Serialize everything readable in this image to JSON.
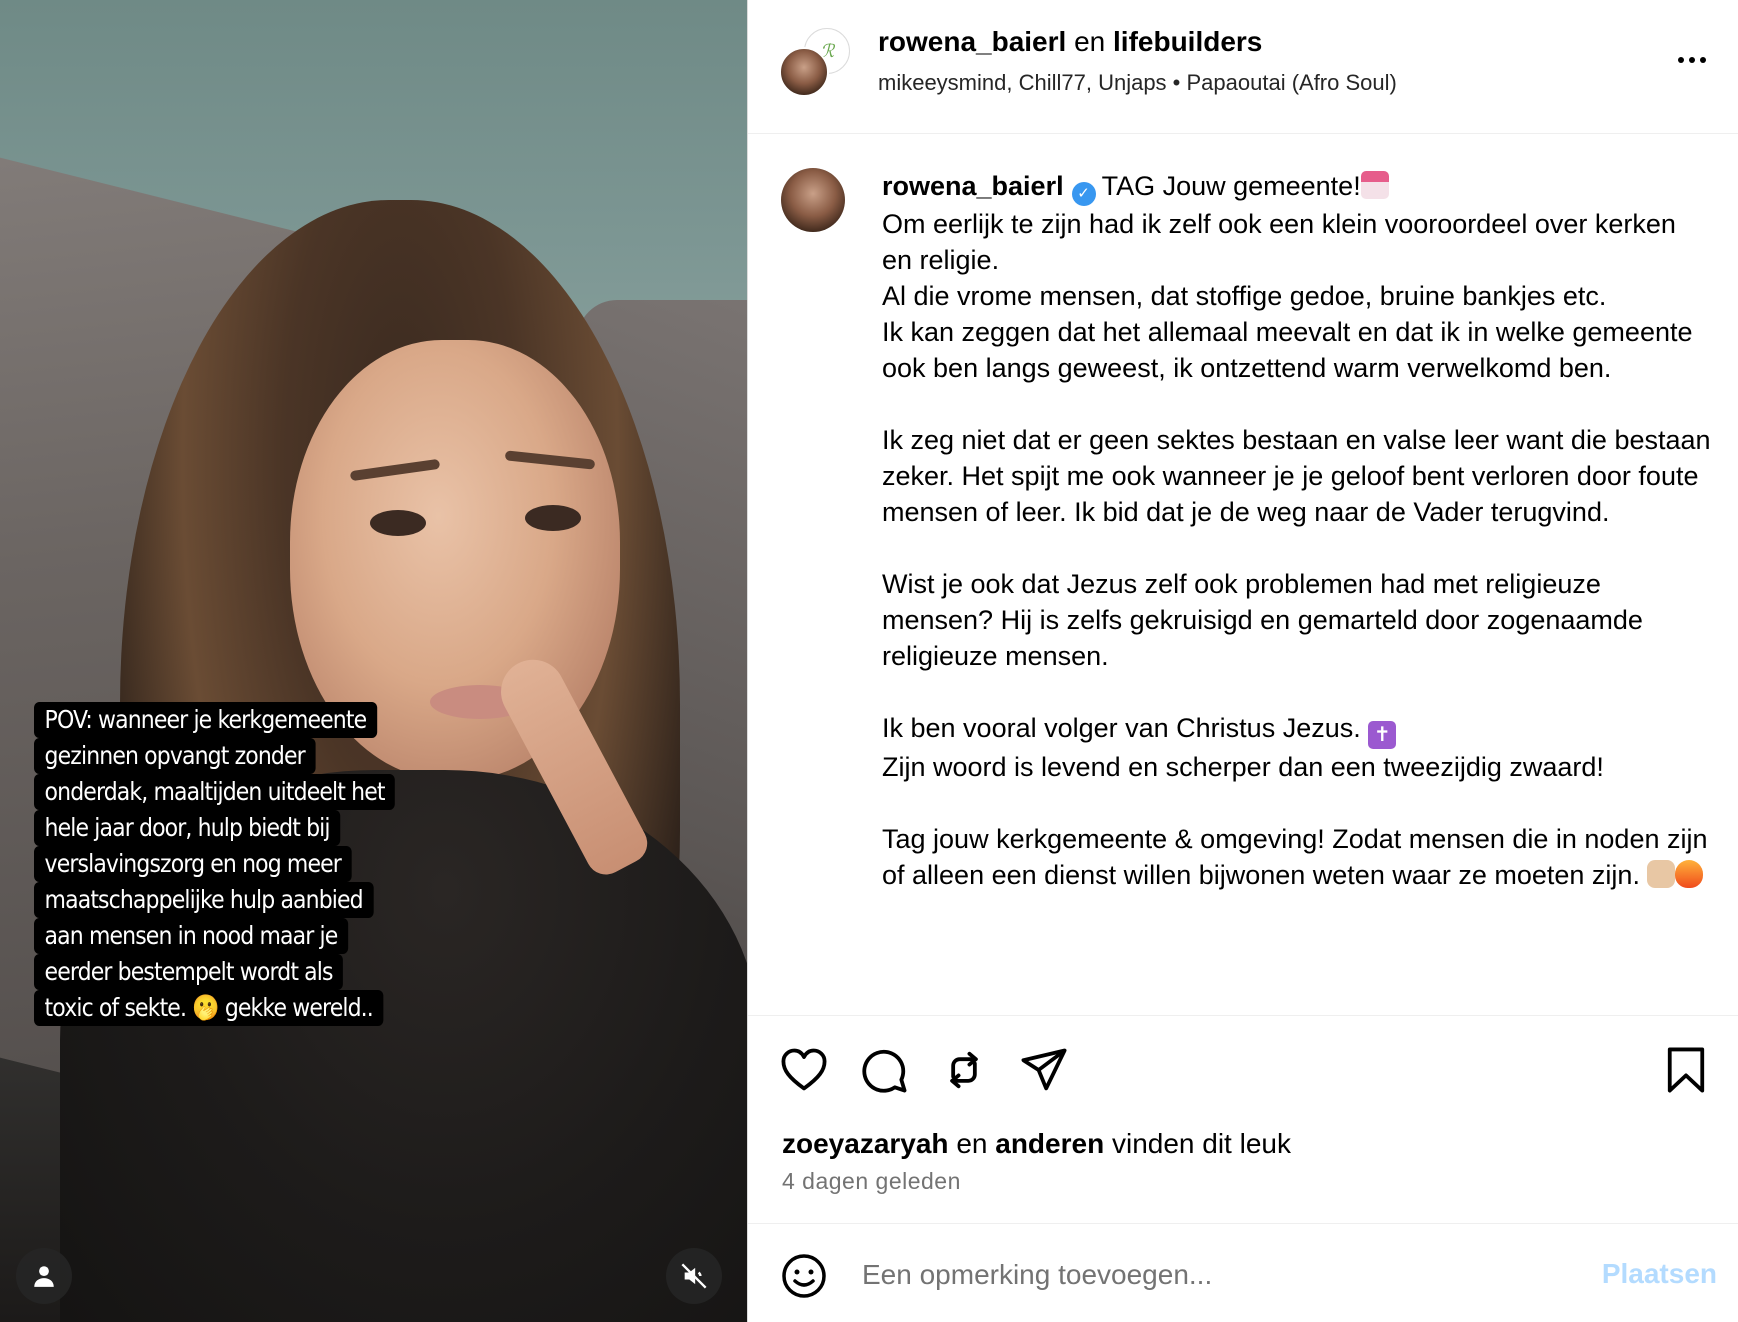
{
  "video": {
    "overlay_lines": [
      "POV: wanneer je kerkgemeente",
      "gezinnen opvangt zonder",
      "onderdak, maaltijden uitdeelt het",
      "hele jaar door, hulp biedt bij",
      "verslavingszorg en nog meer",
      "maatschappelijke hulp aanbied",
      "aan mensen in nood maar je",
      "eerder bestempelt wordt als",
      "toxic of sekte. 🫢 gekke wereld.."
    ]
  },
  "header": {
    "author": "rowena_baierl",
    "connector": " en ",
    "collaborator": "lifebuilders",
    "collab_logo": "ℛ",
    "tagged_users": "mikeeysmind, Chill77, Unjaps",
    "separator": " • ",
    "audio": "Papaoutai (Afro Soul)"
  },
  "caption": {
    "username": "rowena_baierl",
    "verified_mark": "✓",
    "title": "TAG Jouw gemeente!",
    "p1": "Om eerlijk te zijn had ik zelf ook een klein vooroordeel over kerken en religie.\nAl die vrome mensen, dat stoffige gedoe, bruine bankjes etc.\nIk kan zeggen dat het allemaal meevalt en dat ik in welke gemeente ook ben langs geweest, ik ontzettend warm verwelkomd ben.",
    "p2": "Ik zeg niet dat er geen sektes bestaan en valse leer want die bestaan zeker. Het spijt me ook wanneer je je geloof bent verloren door foute mensen of leer. Ik bid dat je de weg naar de Vader terugvind.",
    "p3": "Wist je ook dat Jezus zelf ook problemen had met religieuze mensen? Hij is zelfs gekruisigd en gemarteld door zogenaamde religieuze mensen.",
    "p4a": "Ik ben vooral volger van Christus Jezus. ",
    "p4b": "Zijn woord is levend en scherper dan een tweezijdig zwaard!",
    "p5": "Tag jouw kerkgemeente & omgeving! Zodat mensen die in noden zijn of alleen een dienst willen bijwonen weten waar ze moeten zijn. ",
    "cross_glyph": "✝"
  },
  "actions": {
    "liked_by": "zoeyazaryah",
    "likes_connector": " en ",
    "likes_others": "anderen",
    "likes_suffix": " vinden dit leuk",
    "time_ago": "4 dagen geleden"
  },
  "comment": {
    "placeholder": "Een opmerking toevoegen...",
    "post_label": "Plaatsen"
  },
  "colors": {
    "verified": "#3897f0",
    "post_button_disabled": "#b3dbff",
    "secondary_text": "#737373"
  }
}
